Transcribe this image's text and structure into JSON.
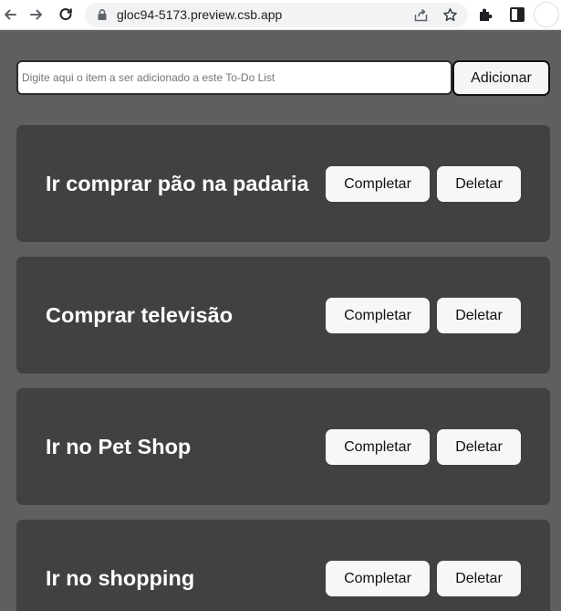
{
  "browser": {
    "url": "gloc94-5173.preview.csb.app",
    "icons": [
      "back-arrow-icon",
      "forward-arrow-icon",
      "reload-icon",
      "lock-icon",
      "share-icon",
      "star-icon",
      "extensions-icon",
      "side-panel-icon",
      "profile-avatar"
    ]
  },
  "form": {
    "placeholder": "Digite aqui o item a ser adicionado a este To-Do List",
    "value": "",
    "add_label": "Adicionar"
  },
  "todos": [
    {
      "title": "Ir comprar pão na padaria",
      "complete_label": "Completar",
      "delete_label": "Deletar"
    },
    {
      "title": "Comprar televisão",
      "complete_label": "Completar",
      "delete_label": "Deletar"
    },
    {
      "title": "Ir no Pet Shop",
      "complete_label": "Completar",
      "delete_label": "Deletar"
    },
    {
      "title": "Ir no shopping",
      "complete_label": "Completar",
      "delete_label": "Deletar"
    }
  ],
  "colors": {
    "page_background": "#5f5f5f",
    "card_background": "#414141",
    "card_text": "#ffffff",
    "button_background": "#f7f7f7"
  }
}
